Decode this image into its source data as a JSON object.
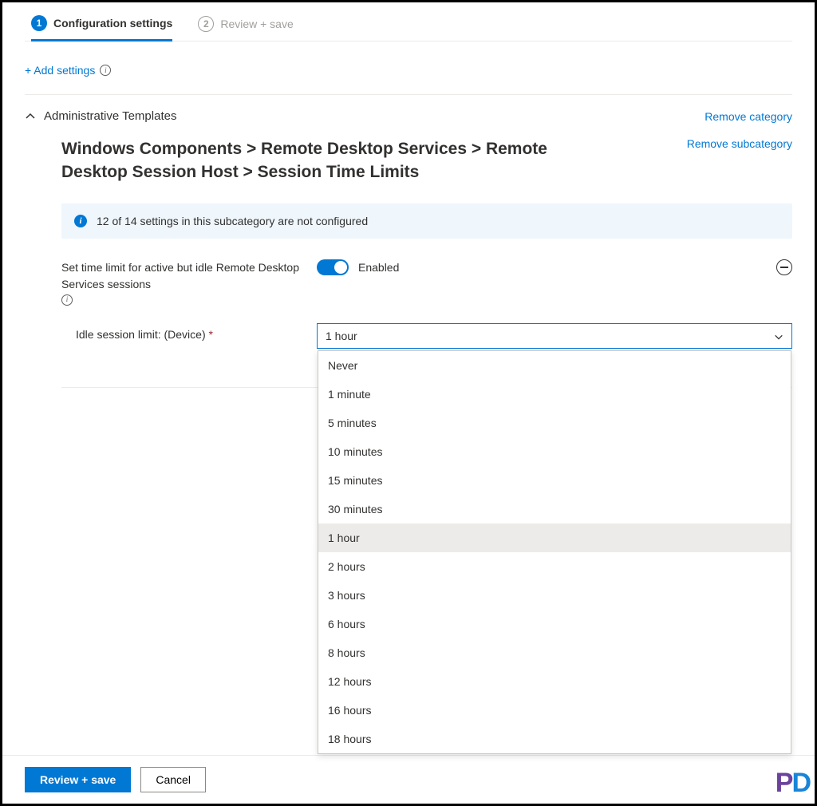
{
  "steps": {
    "step1": {
      "num": "1",
      "label": "Configuration settings"
    },
    "step2": {
      "num": "2",
      "label": "Review + save"
    }
  },
  "add_settings": "+ Add settings",
  "category": {
    "title": "Administrative Templates",
    "remove": "Remove category"
  },
  "subcategory": {
    "breadcrumb": "Windows Components > Remote Desktop Services > Remote Desktop Session Host > Session Time Limits",
    "remove": "Remove subcategory"
  },
  "notice": "12 of 14 settings in this subcategory are not configured",
  "setting": {
    "label": "Set time limit for active but idle Remote Desktop Services sessions",
    "toggle_label": "Enabled"
  },
  "field": {
    "label": "Idle session limit: (Device)",
    "required": "*",
    "selected": "1 hour",
    "options": [
      "Never",
      "1 minute",
      "5 minutes",
      "10 minutes",
      "15 minutes",
      "30 minutes",
      "1 hour",
      "2 hours",
      "3 hours",
      "6 hours",
      "8 hours",
      "12 hours",
      "16 hours",
      "18 hours"
    ]
  },
  "footer": {
    "primary": "Review + save",
    "secondary": "Cancel"
  },
  "watermark": {
    "p": "P",
    "d": "D"
  }
}
